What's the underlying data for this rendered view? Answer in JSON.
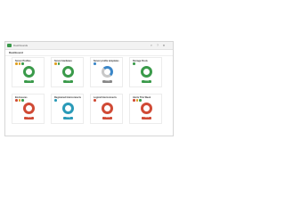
{
  "app": {
    "name": "Dashboards"
  },
  "header": {
    "title": "Dashboard"
  },
  "cards": [
    {
      "title": "Server Profiles",
      "status": "Okay",
      "status_color": "#3a9a4a",
      "ring_color": "#3a9a4a",
      "dots": [
        "#e0a020",
        "#e0a020",
        "#3a9a4a"
      ]
    },
    {
      "title": "Server Hardware",
      "status": "Okay",
      "status_color": "#3a9a4a",
      "ring_color": "#3a9a4a",
      "dots": [
        "#e0a020",
        "#3a9a4a"
      ]
    },
    {
      "title": "Server profile templates",
      "status": "Okay",
      "status_color": "#888888",
      "ring_color": "#3a86c8",
      "dots": [
        "#3a86c8"
      ]
    },
    {
      "title": "Storage Pools",
      "status": "Okay",
      "status_color": "#3a9a4a",
      "ring_color": "#3a9a4a",
      "dots": [
        "#3a9a4a"
      ]
    },
    {
      "title": "Enclosures",
      "status": "Critical",
      "status_color": "#d04a35",
      "ring_color": "#d04a35",
      "dots": [
        "#d04a35",
        "#e0a020",
        "#3a9a4a"
      ]
    },
    {
      "title": "Registered Interconnects",
      "status": "Okay",
      "status_color": "#2a9ab8",
      "ring_color": "#2a9ab8",
      "dots": [
        "#2a9ab8"
      ]
    },
    {
      "title": "Logical Interconnects",
      "status": "Critical",
      "status_color": "#d04a35",
      "ring_color": "#d04a35",
      "dots": [
        "#d04a35"
      ]
    },
    {
      "title": "Alerts This Week",
      "status": "Critical",
      "status_color": "#d04a35",
      "ring_color": "#d04a35",
      "dots": [
        "#d04a35",
        "#e0a020",
        "#3a9a4a"
      ]
    }
  ]
}
